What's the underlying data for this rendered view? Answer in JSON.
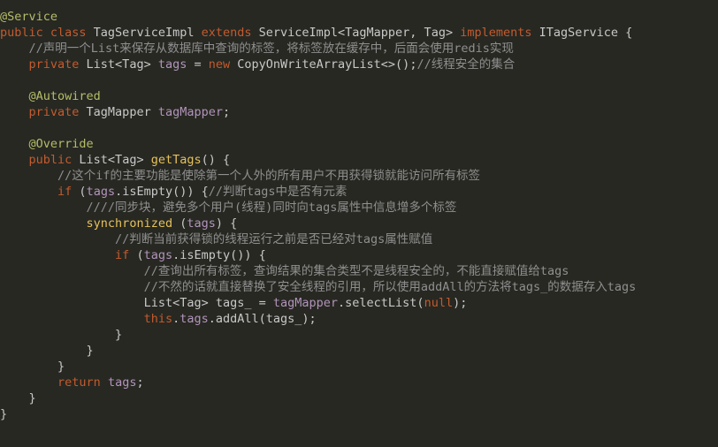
{
  "colors": {
    "background": "#272822",
    "annotation": "#b5bd68",
    "keyword": "#c35b2f",
    "identifier": "#c8c8c8",
    "comment": "#8f8f8f",
    "field": "#b294bb",
    "method": "#e6c15a"
  },
  "lines": [
    [
      [
        "ann",
        "@Service"
      ]
    ],
    [
      [
        "kw",
        "public class "
      ],
      [
        "id",
        "TagServiceImpl "
      ],
      [
        "kw",
        "extends "
      ],
      [
        "id",
        "ServiceImpl<TagMapper, Tag> "
      ],
      [
        "kw",
        "implements "
      ],
      [
        "id",
        "ITagService {"
      ]
    ],
    [
      [
        "id",
        "    "
      ],
      [
        "cm",
        "//声明一个List来保存从数据库中查询的标签，将标签放在缓存中，后面会使用redis实现"
      ]
    ],
    [
      [
        "id",
        "    "
      ],
      [
        "kw",
        "private "
      ],
      [
        "id",
        "List<Tag> "
      ],
      [
        "fld",
        "tags"
      ],
      [
        "id",
        " = "
      ],
      [
        "kw",
        "new "
      ],
      [
        "id",
        "CopyOnWriteArrayList<>();"
      ],
      [
        "cm",
        "//线程安全的集合"
      ]
    ],
    [],
    [
      [
        "id",
        "    "
      ],
      [
        "ann",
        "@Autowired"
      ]
    ],
    [
      [
        "id",
        "    "
      ],
      [
        "kw",
        "private "
      ],
      [
        "id",
        "TagMapper "
      ],
      [
        "fld",
        "tagMapper"
      ],
      [
        "id",
        ";"
      ]
    ],
    [],
    [
      [
        "id",
        "    "
      ],
      [
        "ann",
        "@Override"
      ]
    ],
    [
      [
        "id",
        "    "
      ],
      [
        "kw",
        "public "
      ],
      [
        "id",
        "List<Tag> "
      ],
      [
        "fn",
        "getTags"
      ],
      [
        "id",
        "() {"
      ]
    ],
    [
      [
        "id",
        "        "
      ],
      [
        "cm",
        "//这个if的主要功能是使除第一个人外的所有用户不用获得锁就能访问所有标签"
      ]
    ],
    [
      [
        "id",
        "        "
      ],
      [
        "kw",
        "if "
      ],
      [
        "id",
        "("
      ],
      [
        "fld",
        "tags"
      ],
      [
        "id",
        ".isEmpty()) {"
      ],
      [
        "cm",
        "//判断tags中是否有元素"
      ]
    ],
    [
      [
        "id",
        "            "
      ],
      [
        "cm",
        "////同步块，避免多个用户(线程)同时向tags属性中信息增多个标签"
      ]
    ],
    [
      [
        "id",
        "            "
      ],
      [
        "fn",
        "synchronized "
      ],
      [
        "id",
        "("
      ],
      [
        "fld",
        "tags"
      ],
      [
        "id",
        ") {"
      ]
    ],
    [
      [
        "id",
        "                "
      ],
      [
        "cm",
        "//判断当前获得锁的线程运行之前是否已经对tags属性赋值"
      ]
    ],
    [
      [
        "id",
        "                "
      ],
      [
        "kw",
        "if "
      ],
      [
        "id",
        "("
      ],
      [
        "fld",
        "tags"
      ],
      [
        "id",
        ".isEmpty()) {"
      ]
    ],
    [
      [
        "id",
        "                    "
      ],
      [
        "cm",
        "//查询出所有标签，查询结果的集合类型不是线程安全的，不能直接赋值给tags"
      ]
    ],
    [
      [
        "id",
        "                    "
      ],
      [
        "cm",
        "//不然的话就直接替换了安全线程的引用，所以使用addAll的方法将tags_的数据存入tags"
      ]
    ],
    [
      [
        "id",
        "                    "
      ],
      [
        "id",
        "List<Tag> tags_ = "
      ],
      [
        "fld",
        "tagMapper"
      ],
      [
        "id",
        ".selectList("
      ],
      [
        "kw",
        "null"
      ],
      [
        "id",
        ");"
      ]
    ],
    [
      [
        "id",
        "                    "
      ],
      [
        "kw",
        "this"
      ],
      [
        "id",
        "."
      ],
      [
        "fld",
        "tags"
      ],
      [
        "id",
        ".addAll(tags_);"
      ]
    ],
    [
      [
        "id",
        "                }"
      ]
    ],
    [
      [
        "id",
        "            }"
      ]
    ],
    [
      [
        "id",
        "        }"
      ]
    ],
    [
      [
        "id",
        "        "
      ],
      [
        "kw",
        "return "
      ],
      [
        "fld",
        "tags"
      ],
      [
        "id",
        ";"
      ]
    ],
    [
      [
        "id",
        "    }"
      ]
    ],
    [
      [
        "id",
        "}"
      ]
    ]
  ]
}
